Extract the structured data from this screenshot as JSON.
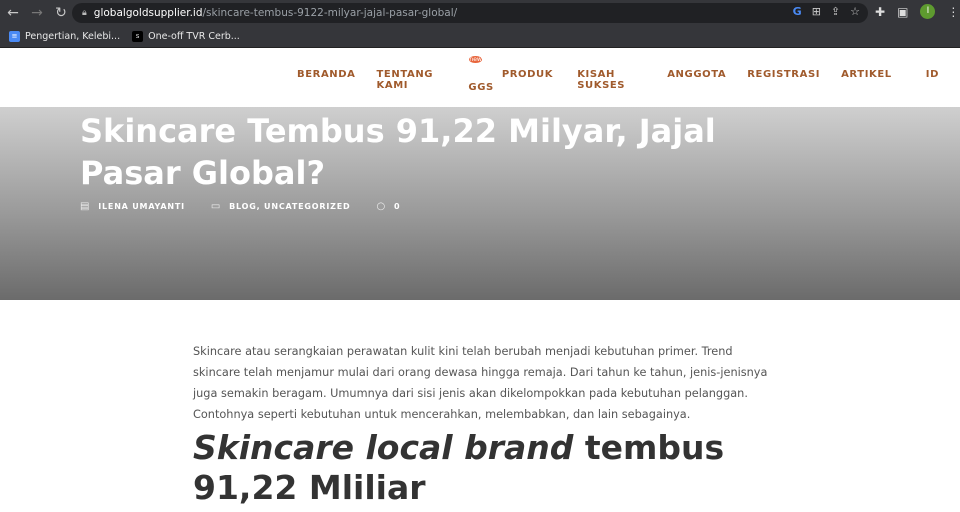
{
  "browser": {
    "url_host": "globalgoldsupplier.id",
    "url_path": "/skincare-tembus-9122-milyar-jajal-pasar-global/",
    "profile_initial": "I",
    "bookmarks": [
      {
        "label": "Pengertian, Kelebi...",
        "icon": "docs-icon"
      },
      {
        "label": "One-off TVR Cerb...",
        "icon": "site-icon"
      }
    ]
  },
  "nav": {
    "items": [
      "BERANDA",
      "TENTANG KAMI",
      "PRODUK GGS",
      "KISAH SUKSES",
      "ANGGOTA",
      "REGISTRASI",
      "ARTIKEL",
      "ID"
    ],
    "badge": "new"
  },
  "post": {
    "title": "Skincare Tembus 91,22 Milyar, Jajal Pasar Global?",
    "author": "ILENA UMAYANTI",
    "categories": "BLOG, UNCATEGORIZED",
    "comments": "0",
    "paragraph": "Skincare atau serangkaian perawatan kulit kini telah berubah menjadi kebutuhan primer. Trend skincare telah menjamur mulai dari orang dewasa hingga remaja. Dari tahun ke tahun, jenis-jenisnya juga semakin beragam. Umumnya dari sisi jenis akan dikelompokkan pada kebutuhan pelanggan. Contohnya seperti kebutuhan untuk mencerahkan, melembabkan, dan lain sebagainya.",
    "heading_italic": "Skincare local brand",
    "heading_rest": " tembus  91,22 Mliliar"
  }
}
